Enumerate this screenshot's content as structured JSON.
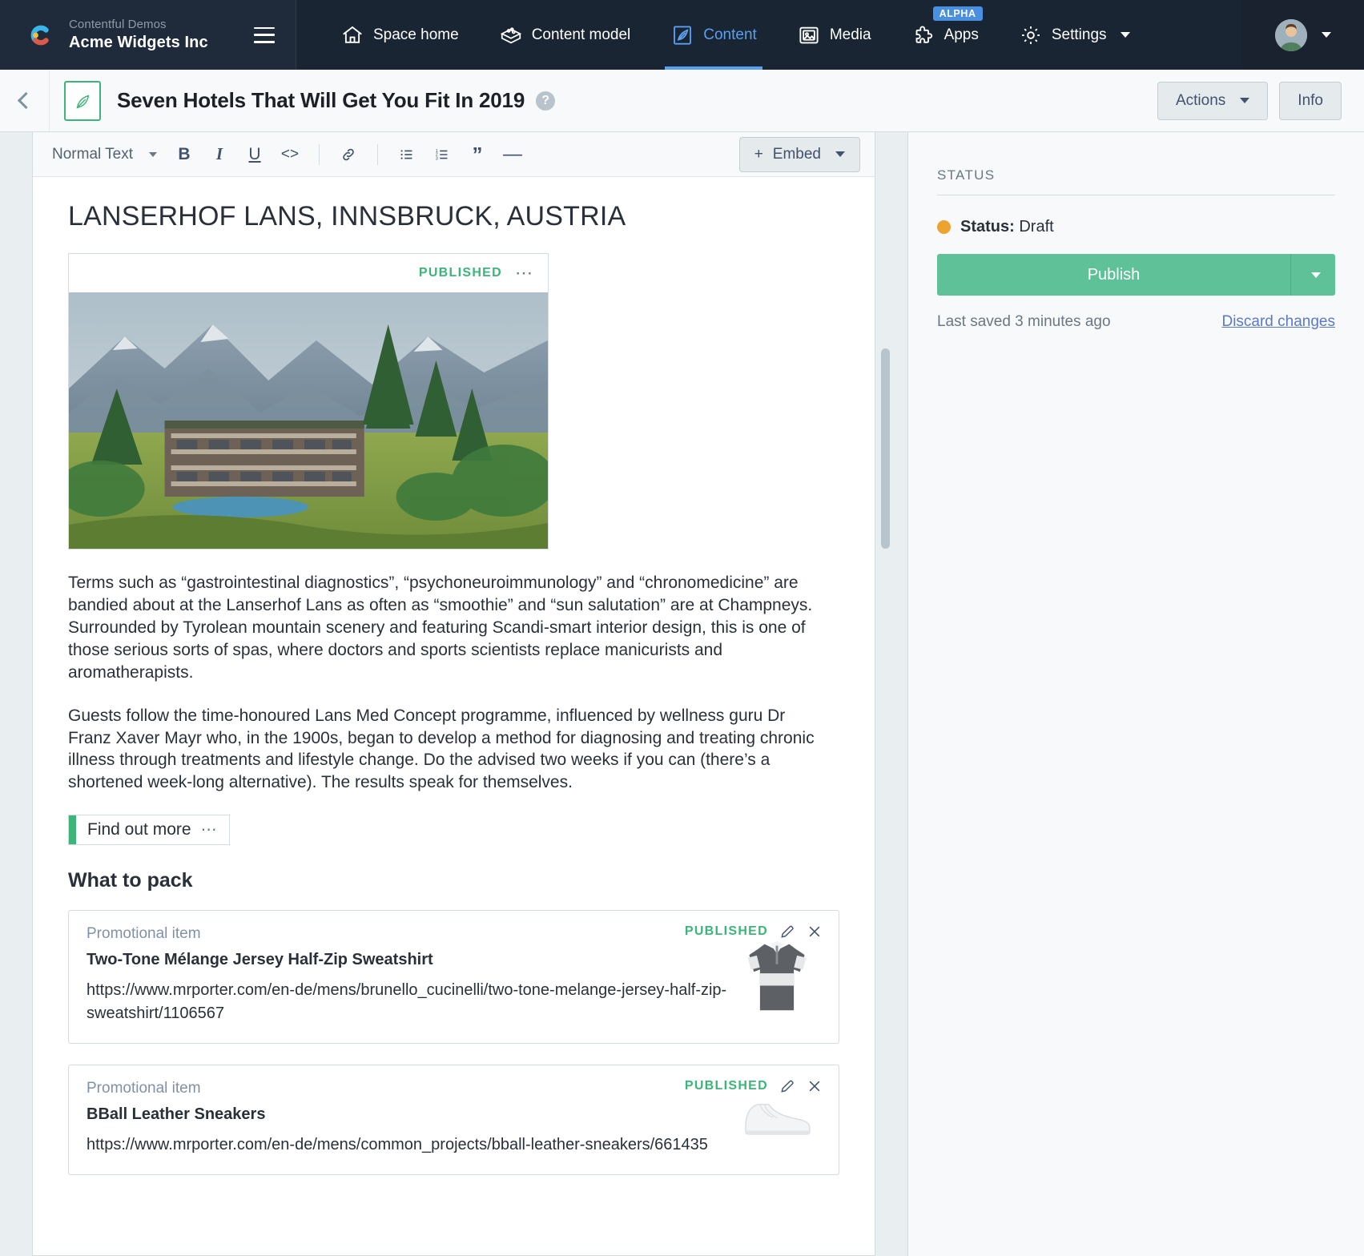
{
  "topnav": {
    "org": "Contentful Demos",
    "space": "Acme Widgets Inc",
    "logo_icon": "contentful-logo-icon",
    "menu_icon": "hamburger-menu-icon",
    "items": [
      {
        "label": "Space home",
        "icon": "home-icon",
        "active": false
      },
      {
        "label": "Content model",
        "icon": "content-model-icon",
        "active": false
      },
      {
        "label": "Content",
        "icon": "content-pen-icon",
        "active": true
      },
      {
        "label": "Media",
        "icon": "media-image-icon",
        "active": false
      },
      {
        "label": "Apps",
        "icon": "puzzle-piece-icon",
        "active": false,
        "badge": "ALPHA"
      },
      {
        "label": "Settings",
        "icon": "gear-icon",
        "active": false,
        "caret": true
      }
    ],
    "avatar_icon": "user-avatar",
    "accent_color": "#5b9fef",
    "background_color": "#192532"
  },
  "entry_header": {
    "back_icon": "chevron-left-icon",
    "entry_icon": "leaf-entry-icon",
    "title": "Seven Hotels That Will Get You Fit In 2019",
    "help_icon": "question-mark-icon",
    "help_glyph": "?",
    "actions_label": "Actions",
    "info_label": "Info"
  },
  "toolbar": {
    "style_label": "Normal Text",
    "buttons": [
      {
        "name": "bold-button",
        "glyph": "B"
      },
      {
        "name": "italic-button",
        "glyph": "I"
      },
      {
        "name": "underline-button",
        "glyph": "U"
      },
      {
        "name": "code-button",
        "glyph": "<>"
      },
      {
        "name": "link-button",
        "glyph": "link-icon"
      },
      {
        "name": "bullet-list-button",
        "glyph": "bullet-list-icon"
      },
      {
        "name": "numbered-list-button",
        "glyph": "numbered-list-icon"
      },
      {
        "name": "quote-button",
        "glyph": "”"
      },
      {
        "name": "horizontal-rule-button",
        "glyph": "—"
      }
    ],
    "embed_label": "Embed",
    "embed_plus": "+"
  },
  "document": {
    "heading": "LANSERHOF LANS, INNSBRUCK, AUSTRIA",
    "asset": {
      "status": "PUBLISHED",
      "actions_icon": "ellipsis-icon",
      "alt": "Modern hotel building in Tyrolean mountain landscape"
    },
    "paragraphs": [
      "Terms such as “gastrointestinal diagnostics”, “psychoneuroimmunology” and “chronomedicine” are bandied about at the Lanserhof Lans as often as “smoothie” and “sun salutation” are at Champneys. Surrounded by Tyrolean mountain scenery and featuring Scandi-smart interior design, this is one of those serious sorts of spas, where doctors and sports scientists replace manicurists and aromatherapists.",
      "Guests follow the time-honoured Lans Med Concept programme, influenced by wellness guru Dr Franz Xaver Mayr who, in the 1900s, began to develop a method for diagnosing and treating chronic illness through treatments and lifestyle change. Do the advised two weeks if you can (there’s a shortened week-long alternative). The results speak for themselves."
    ],
    "inline_entry": {
      "label": "Find out more",
      "actions_icon": "ellipsis-icon"
    },
    "section_heading": "What to pack",
    "entry_cards": [
      {
        "type": "Promotional item",
        "title": "Two-Tone Mélange Jersey Half-Zip Sweatshirt",
        "url": "https://www.mrporter.com/en-de/mens/brunello_cucinelli/two-tone-melange-jersey-half-zip-sweatshirt/1106567",
        "status": "PUBLISHED",
        "edit_icon": "pencil-icon",
        "remove_icon": "close-icon",
        "thumb": "sweatshirt"
      },
      {
        "type": "Promotional item",
        "title": "BBall Leather Sneakers",
        "url": "https://www.mrporter.com/en-de/mens/common_projects/bball-leather-sneakers/661435",
        "status": "PUBLISHED",
        "edit_icon": "pencil-icon",
        "remove_icon": "close-icon",
        "thumb": "sneaker"
      }
    ]
  },
  "sidebar": {
    "status_section_label": "STATUS",
    "status_prefix": "Status:",
    "status_value": "Draft",
    "status_color": "#eca32f",
    "publish_label": "Publish",
    "publish_color": "#5ec198",
    "last_saved": "Last saved 3 minutes ago",
    "discard_label": "Discard changes",
    "link_color": "#5b79c9"
  }
}
